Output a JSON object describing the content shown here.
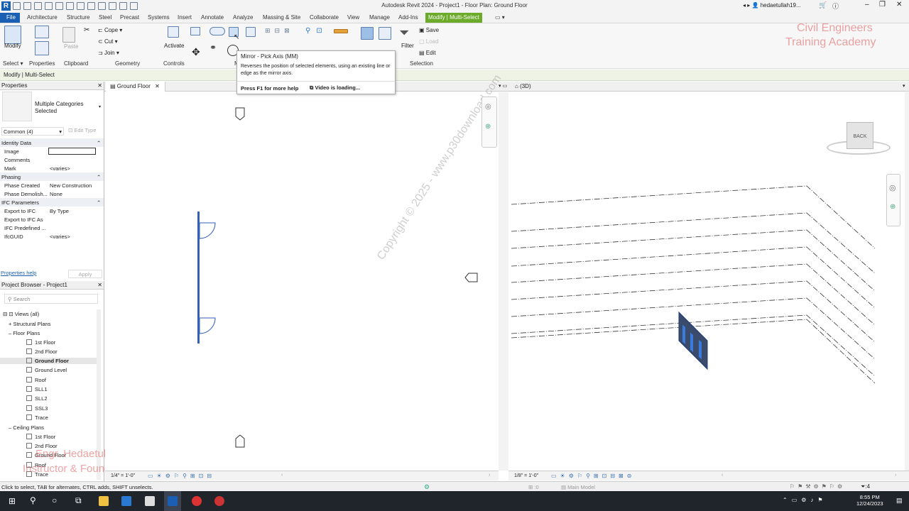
{
  "app": {
    "title": "Autodesk Revit 2024 - Project1 - Floor Plan: Ground Floor",
    "user": "hedaetullah19..."
  },
  "menu": [
    "File",
    "Architecture",
    "Structure",
    "Steel",
    "Precast",
    "Systems",
    "Insert",
    "Annotate",
    "Analyze",
    "Massing & Site",
    "Collaborate",
    "View",
    "Manage",
    "Add-Ins",
    "Modify | Multi-Select"
  ],
  "ribbon": {
    "modify": "Modify",
    "cope": "Cope",
    "cut": "Cut",
    "join": "Join",
    "paste": "Paste",
    "activate": "Activate",
    "filter": "Filter",
    "save": "Save",
    "load": "Load",
    "edit": "Edit",
    "panels": [
      "Select",
      "Properties",
      "Clipboard",
      "Geometry",
      "Controls",
      "M",
      "Selection"
    ]
  },
  "tooltip": {
    "title": "Mirror - Pick Axis",
    "shortcut": "(MM)",
    "desc": "Reverses the position of selected elements, using an existing line or edge as the mirror axis.",
    "help": "Press F1 for more help",
    "video": "Video is loading..."
  },
  "options_bar": "Modify | Multi-Select",
  "watermark": {
    "line1": "Civil Engineers",
    "line2": "Training Academy",
    "instructor1": "Engr. Hedaetullah",
    "instructor2": "Instructor & Founder",
    "diag": "Copyright © 2025 - www.p30download.com"
  },
  "properties": {
    "header": "Properties",
    "type": "Multiple Categories Selected",
    "filter": "Common (4)",
    "edit_type": "Edit Type",
    "sections": {
      "identity": "Identity Data",
      "phasing": "Phasing",
      "ifc": "IFC Parameters"
    },
    "rows": [
      {
        "k": "Image",
        "v": ""
      },
      {
        "k": "Comments",
        "v": ""
      },
      {
        "k": "Mark",
        "v": "<varies>"
      },
      {
        "k": "Phase Created",
        "v": "New Construction"
      },
      {
        "k": "Phase Demolish...",
        "v": "None"
      },
      {
        "k": "Export to IFC",
        "v": "By Type"
      },
      {
        "k": "Export to IFC As",
        "v": ""
      },
      {
        "k": "IFC Predefined ...",
        "v": ""
      },
      {
        "k": "IfcGUID",
        "v": "<varies>"
      }
    ],
    "help": "Properties help",
    "apply": "Apply"
  },
  "browser": {
    "header": "Project Browser - Project1",
    "search": "Search",
    "items": [
      {
        "label": "Views (all)"
      },
      {
        "label": "Structural Plans"
      },
      {
        "label": "Floor Plans"
      },
      {
        "label": "1st Floor"
      },
      {
        "label": "2nd Floor"
      },
      {
        "label": "Ground Floor"
      },
      {
        "label": "Ground Level"
      },
      {
        "label": "Roof"
      },
      {
        "label": "SLL1"
      },
      {
        "label": "SLL2"
      },
      {
        "label": "SSL3"
      },
      {
        "label": "Trace"
      },
      {
        "label": "Ceiling Plans"
      },
      {
        "label": "1st Floor"
      },
      {
        "label": "2nd Floor"
      },
      {
        "label": "Ground Floor"
      },
      {
        "label": "Roof"
      },
      {
        "label": "Trace"
      }
    ]
  },
  "views": {
    "tab1": "Ground Floor",
    "tab2": "(3D)",
    "scale1": "1/4\" = 1'-0\"",
    "scale2": "1/8\" = 1'-0\"",
    "cube": "BACK"
  },
  "status": {
    "hint": "Click to select, TAB for alternates, CTRL adds, SHIFT unselects.",
    "model": "Main Model",
    "filter_count": ":4"
  },
  "clock": {
    "time": "8:55 PM",
    "date": "12/24/2023"
  }
}
